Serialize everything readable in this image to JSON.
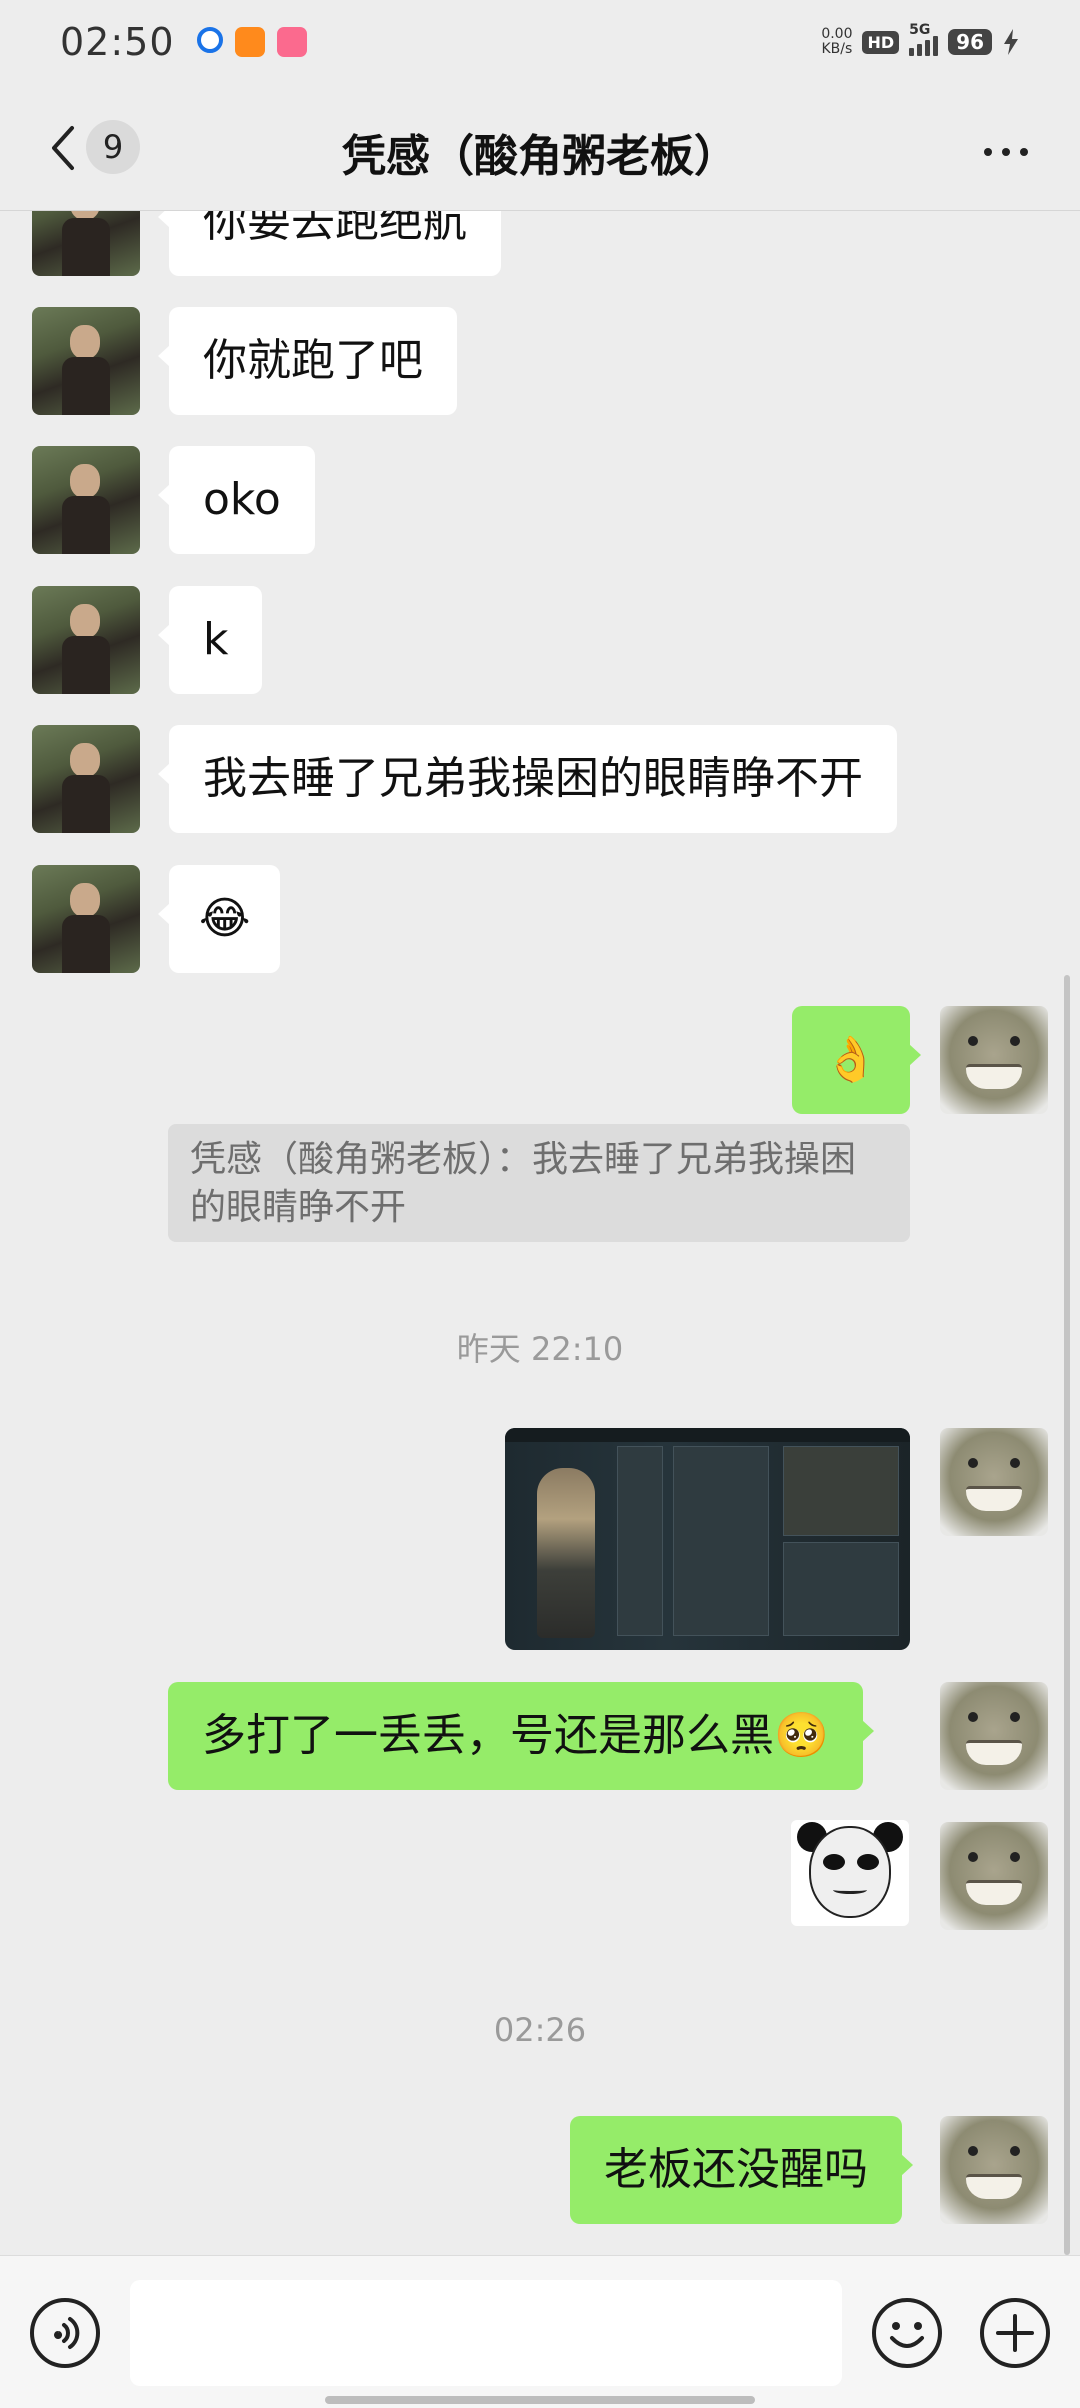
{
  "status_bar": {
    "time": "02:50",
    "net_speed_value": "0.00",
    "net_speed_unit": "KB/s",
    "hd_label": "HD",
    "network_label": "5G",
    "battery_level": "96",
    "notification_icons": [
      "app-icon-blue",
      "app-icon-orange",
      "bilibili-icon"
    ]
  },
  "header": {
    "back_unread_count": "9",
    "title": "凭感（酸角粥老板）"
  },
  "messages": [
    {
      "side": "in",
      "type": "text",
      "text": "你要去跑绝航"
    },
    {
      "side": "in",
      "type": "text",
      "text": "你就跑了吧"
    },
    {
      "side": "in",
      "type": "text",
      "text": "oko"
    },
    {
      "side": "in",
      "type": "text",
      "text": "k"
    },
    {
      "side": "in",
      "type": "text",
      "text": "我去睡了兄弟我操困的眼睛睁不开"
    },
    {
      "side": "in",
      "type": "emoji",
      "text": "😂"
    },
    {
      "side": "out",
      "type": "emoji",
      "text": "👌"
    },
    {
      "side": "quote",
      "type": "quote",
      "text": "凭感（酸角粥老板）：我去睡了兄弟我操困的眼睛睁不开"
    },
    {
      "side": "center",
      "type": "timestamp",
      "text": "昨天 22:10"
    },
    {
      "side": "out",
      "type": "image",
      "text": "game-screenshot"
    },
    {
      "side": "out",
      "type": "text",
      "text": "多打了一丢丢，号还是那么黑🥺"
    },
    {
      "side": "out",
      "type": "sticker",
      "text": "panda-meme-sticker"
    },
    {
      "side": "center",
      "type": "timestamp",
      "text": "02:26"
    },
    {
      "side": "out",
      "type": "text",
      "text": "老板还没醒吗"
    }
  ],
  "input_bar": {
    "voice_icon": "voice-icon",
    "emoji_icon": "emoji-icon",
    "plus_icon": "plus-icon",
    "value": ""
  },
  "colors": {
    "background": "#ededed",
    "incoming_bubble": "#ffffff",
    "outgoing_bubble": "#95ec69",
    "timestamp": "#9a9a9a"
  }
}
